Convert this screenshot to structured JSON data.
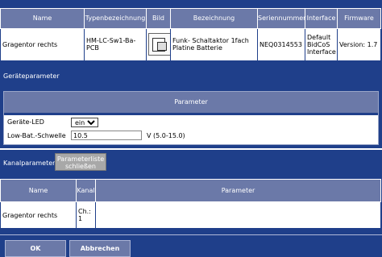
{
  "device_table": {
    "headers": [
      "Name",
      "Typenbezeichnung",
      "Bild",
      "Bezeichnung",
      "Seriennummer",
      "Interface",
      "Firmware"
    ],
    "row": {
      "name": "Gragentor rechts",
      "type": "HM-LC-Sw1-Ba-PCB",
      "description": "Funk- Schaltaktor 1fach Platine Batterie",
      "serial": "NEQ0314553",
      "interface": "Default BidCoS Interface",
      "firmware": "Version: 1.7"
    }
  },
  "geraeteparameter": {
    "section_label": "Geräteparameter",
    "header": "Parameter",
    "led_label": "Geräte-LED",
    "led_value": "ein",
    "bat_label": "Low-Bat.-Schwelle",
    "bat_value": "10.5",
    "bat_hint": "V (5.0-15.0)"
  },
  "kanalparameter": {
    "section_label": "Kanalparameter",
    "toggle_button": "Parameterliste schließen",
    "headers": [
      "Name",
      "Kanal",
      "Parameter"
    ],
    "row": {
      "name": "Gragentor rechts",
      "channel": "Ch.: 1"
    }
  },
  "footer": {
    "ok_label": "OK",
    "cancel_label": "Abbrechen"
  }
}
